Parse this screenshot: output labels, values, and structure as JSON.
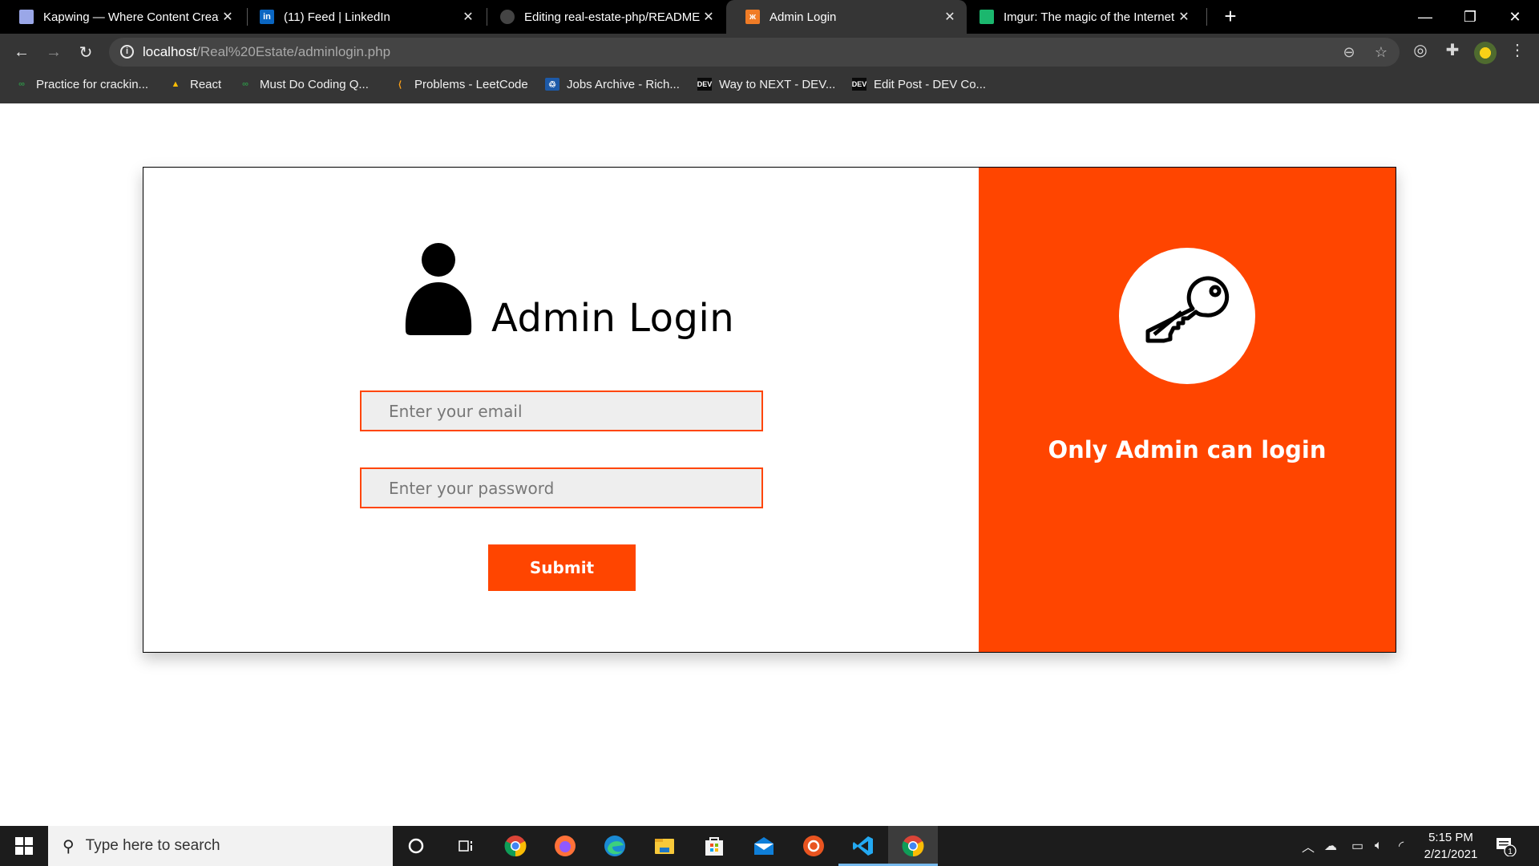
{
  "browser": {
    "tabs": [
      {
        "title": "Kapwing — Where Content Creat",
        "icon": "kapwing-icon",
        "active": false
      },
      {
        "title": "(11) Feed | LinkedIn",
        "icon": "linkedin-icon",
        "active": false
      },
      {
        "title": "Editing real-estate-php/README",
        "icon": "github-icon",
        "active": false
      },
      {
        "title": "Admin Login",
        "icon": "xampp-icon",
        "active": true
      },
      {
        "title": "Imgur: The magic of the Internet",
        "icon": "imgur-icon",
        "active": false
      }
    ],
    "close_glyph": "✕",
    "new_tab_glyph": "+",
    "window_controls": {
      "minimize": "—",
      "restore": "❐",
      "close": "✕"
    },
    "address": {
      "host": "localhost",
      "path": "/Real%20Estate/adminlogin.php"
    },
    "bookmarks": [
      {
        "label": "Practice for crackin...",
        "icon": "geeksforgeeks-icon"
      },
      {
        "label": "React",
        "icon": "google-drive-icon"
      },
      {
        "label": "Must Do Coding Q...",
        "icon": "geeksforgeeks-icon"
      },
      {
        "label": "Problems - LeetCode",
        "icon": "leetcode-icon"
      },
      {
        "label": "Jobs Archive - Rich...",
        "icon": "jobs-icon"
      },
      {
        "label": "Way to NEXT - DEV...",
        "icon": "dev-icon"
      },
      {
        "label": "Edit Post - DEV Co...",
        "icon": "dev-icon"
      }
    ],
    "dev_badge": "DEV"
  },
  "page": {
    "heading": "Admin Login",
    "email_placeholder": "Enter your email",
    "password_placeholder": "Enter your password",
    "submit_label": "Submit",
    "side_text": "Only Admin can login",
    "accent_color": "#ff4500"
  },
  "taskbar": {
    "search_placeholder": "Type here to search",
    "apps": [
      "cortana",
      "task-view",
      "chrome",
      "firefox",
      "edge",
      "file-explorer",
      "microsoft-store",
      "mail",
      "ubuntu",
      "vscode",
      "chrome-active"
    ],
    "time": "5:15 PM",
    "date": "2/21/2021",
    "notification_count": "1"
  }
}
